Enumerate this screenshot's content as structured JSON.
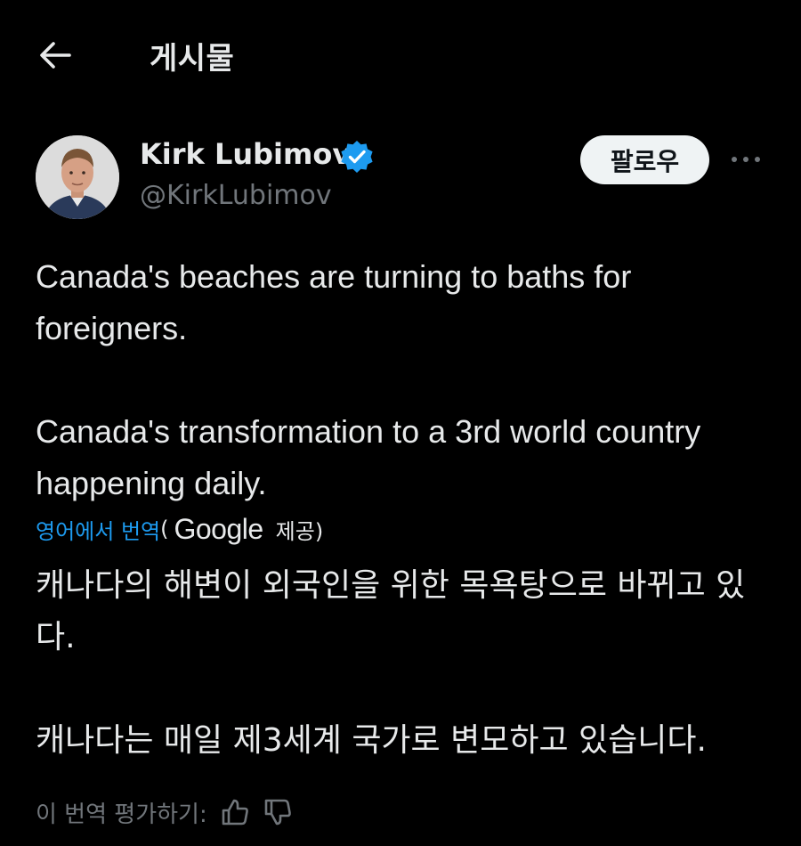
{
  "header": {
    "title": "게시물",
    "back_icon": "arrow-left-icon"
  },
  "author": {
    "name": "Kirk Lubimov",
    "handle": "@KirkLubimov",
    "verified_icon": "verified-badge-icon",
    "verified_color": "#1d9bf0"
  },
  "actions": {
    "follow_label": "팔로우",
    "more_icon": "more-horizontal-icon"
  },
  "tweet": {
    "paragraph1": "Canada's beaches are turning to baths for foreigners.",
    "paragraph2": "Canada's transformation to a 3rd world country happening daily."
  },
  "translation": {
    "link_label": "영어에서 번역",
    "open_paren": "(",
    "provider": "Google",
    "provided_label": "제공)",
    "paragraph1": "캐나다의 해변이 외국인을 위한 목욕탕으로 바뀌고 있다.",
    "paragraph2": "캐나다는 매일 제3세계 국가로 변모하고 있습니다.",
    "rate_label": "이 번역 평가하기:",
    "thumbs_up_icon": "thumbs-up-icon",
    "thumbs_down_icon": "thumbs-down-icon"
  },
  "colors": {
    "background": "#000000",
    "text": "#e7e9ea",
    "secondary": "#71767b",
    "accent": "#1d9bf0"
  }
}
